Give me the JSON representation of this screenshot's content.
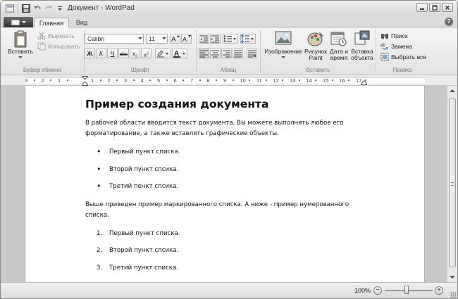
{
  "window": {
    "title": "Документ - WordPad",
    "controls": [
      "minimize",
      "maximize",
      "close"
    ]
  },
  "tabs": [
    {
      "label": "Главная",
      "active": true
    },
    {
      "label": "Вид",
      "active": false
    }
  ],
  "ribbon": {
    "clipboard": {
      "group_label": "Буфер обмена",
      "paste_label": "Вставить",
      "cut_label": "Вырезать",
      "copy_label": "Копировать"
    },
    "font": {
      "group_label": "Шрифт",
      "family": "Calibri",
      "size": "11"
    },
    "paragraph": {
      "group_label": "Абзац"
    },
    "insert": {
      "group_label": "Вставить",
      "image_label": "Изображение",
      "paint_label": "Рисунок Paint",
      "datetime_label": "Дата и время",
      "object_label": "Вставка объекта"
    },
    "edit": {
      "group_label": "Правка",
      "find_label": "Поиск",
      "replace_label": "Замена",
      "select_all_label": "Выбрать все"
    }
  },
  "ruler": {
    "numbers": [
      "3",
      "2",
      "1",
      "1",
      "2",
      "3",
      "4",
      "5",
      "6",
      "7",
      "8",
      "9",
      "10",
      "11",
      "12",
      "13",
      "14",
      "15",
      "16",
      "17"
    ]
  },
  "document": {
    "heading": "Пример создания документа",
    "intro": "В рабочей области вводится текст документа. Вы можете выполнять любое его форматирование, а также вставлять графические объекты.",
    "bullets": [
      "Первый пункт списка.",
      "Второй пункт спсика.",
      "Третий пенкт спсика."
    ],
    "middle": "Выше приведен пример маркированного списка. А ниже  - пример нумерованного списка.",
    "numbered": [
      "Первый пункт списка.",
      "Второй пункт спсика.",
      "Третий пункт списка."
    ],
    "numbered_markers": [
      "1.",
      "2.",
      "3."
    ]
  },
  "status": {
    "zoom": "100%",
    "zoom_out": "−",
    "zoom_in": "+"
  },
  "help": "?"
}
